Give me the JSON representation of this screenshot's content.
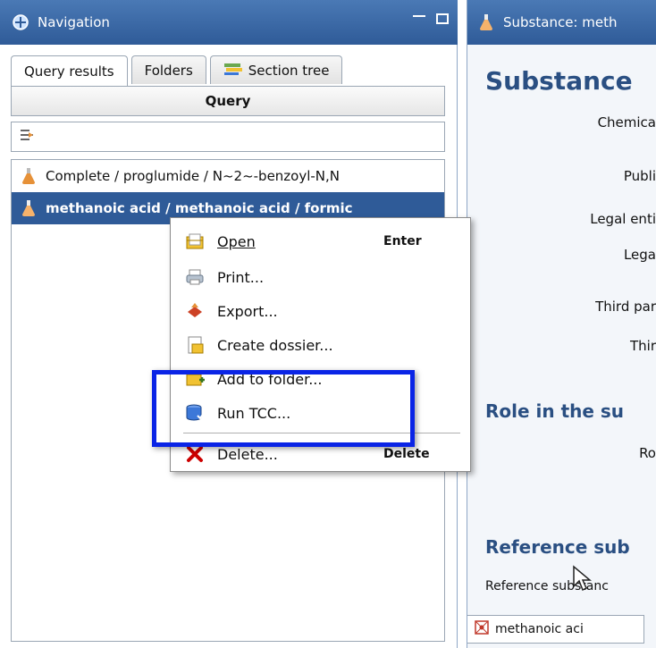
{
  "navigation": {
    "title": "Navigation",
    "tabs": [
      {
        "label": "Query results",
        "icon": "none"
      },
      {
        "label": "Folders",
        "icon": "none"
      },
      {
        "label": "Section tree",
        "icon": "section-tree-icon"
      }
    ],
    "query_button": "Query",
    "filter_icon": "filter-arrow-icon",
    "results": [
      {
        "label": "Complete / proglumide / N~2~-benzoyl-N,N",
        "icon": "flask-icon",
        "selected": false
      },
      {
        "label": "methanoic acid / methanoic acid / formic",
        "icon": "flask-icon",
        "selected": true
      }
    ]
  },
  "context_menu": {
    "items": [
      {
        "label": "Open",
        "shortcut": "Enter",
        "icon": "open-icon"
      },
      {
        "label": "Print...",
        "shortcut": "",
        "icon": "printer-icon"
      },
      {
        "label": "Export...",
        "shortcut": "",
        "icon": "export-icon"
      },
      {
        "label": "Create dossier...",
        "shortcut": "",
        "icon": "dossier-icon"
      },
      {
        "label": "Add to folder...",
        "shortcut": "",
        "icon": "folder-add-icon"
      },
      {
        "label": "Run TCC...",
        "shortcut": "",
        "icon": "database-icon"
      },
      {
        "label": "Delete...",
        "shortcut": "Delete",
        "icon": "delete-icon"
      }
    ]
  },
  "substance_panel": {
    "title": "Substance: meth",
    "heading": "Substance",
    "fields": [
      "Chemica",
      "Publi",
      "Legal enti",
      "Lega",
      "Third par",
      "Thir"
    ],
    "role_heading": "Role in the su",
    "role_field": "Ro",
    "reference_heading": "Reference sub",
    "reference_label": "Reference substanc",
    "reference_value": "methanoic aci"
  },
  "colors": {
    "title_bar": "#2f5b98",
    "selection": "#2f5b98",
    "highlight_box": "#0a24e6",
    "heading": "#2a4f82"
  }
}
